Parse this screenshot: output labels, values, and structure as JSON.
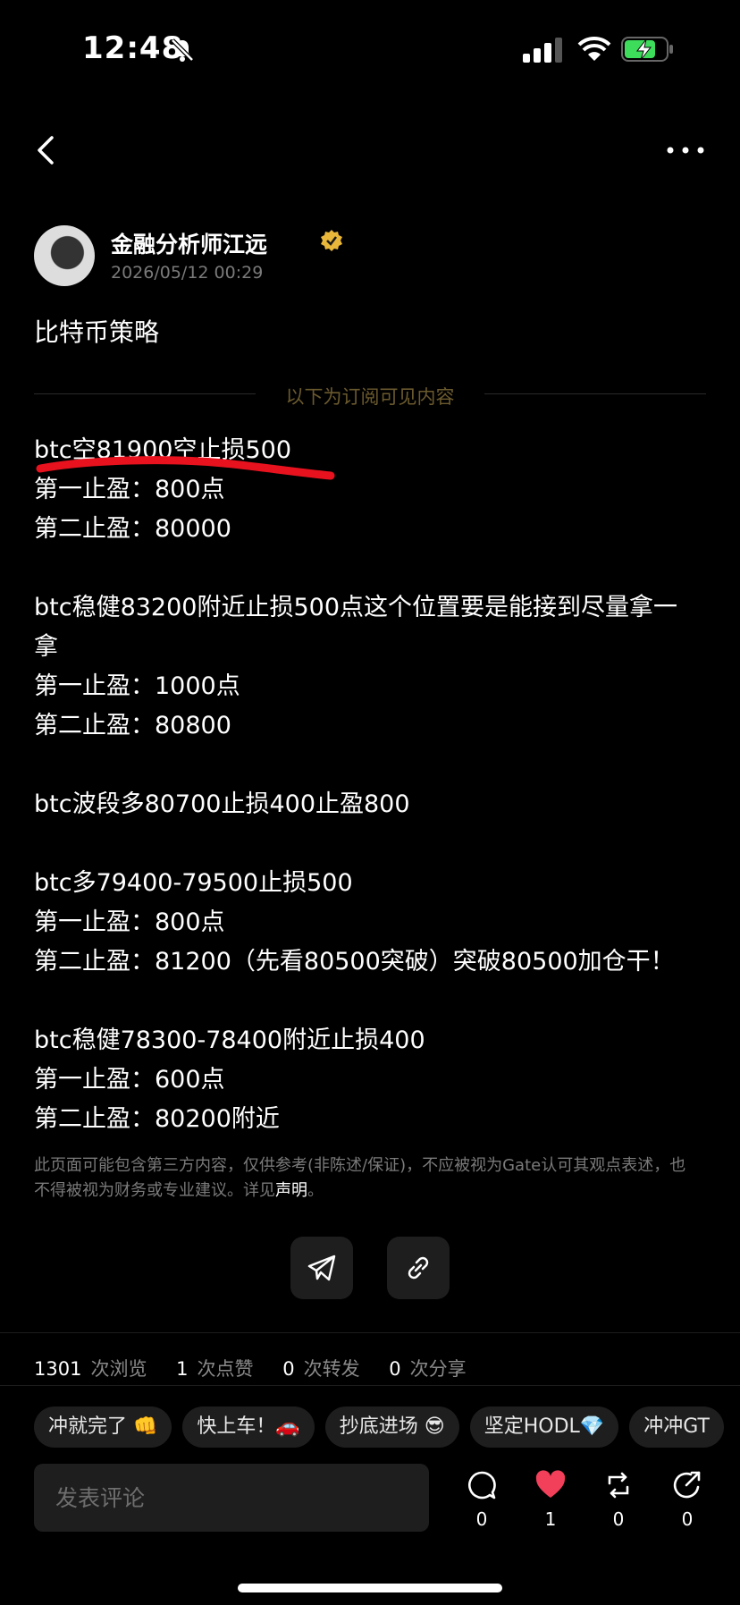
{
  "status_bar": {
    "time": "12:48"
  },
  "author": {
    "name": "金融分析师江远",
    "date": "2026/05/12 00:29"
  },
  "post": {
    "title": "比特币策略",
    "divider_text": "以下为订阅可见内容",
    "lines": [
      "btc空81900空止损500",
      "第一止盈：800点",
      "第二止盈：80000",
      "",
      "btc稳健83200附近止损500点这个位置要是能接到尽量拿一",
      "拿",
      "第一止盈：1000点",
      "第二止盈：80800",
      "",
      "btc波段多80700止损400止盈800",
      "",
      "btc多79400-79500止损500",
      "第一止盈：800点",
      "第二止盈：81200（先看80500突破）突破80500加仓干！",
      "",
      "btc稳健78300-78400附近止损400",
      "第一止盈：600点",
      "第二止盈：80200附近"
    ],
    "disclaimer": "此页面可能包含第三方内容，仅供参考(非陈述/保证)，不应被视为Gate认可其观点表述，也不得被视为财务或专业建议。详见",
    "disclaimer_link": "声明",
    "disclaimer_end": "。"
  },
  "stats": {
    "views": "1301",
    "views_label": "次浏览",
    "likes": "1",
    "likes_label": "次点赞",
    "reposts": "0",
    "reposts_label": "次转发",
    "shares": "0",
    "shares_label": "次分享"
  },
  "chips": [
    "冲就完了 👊",
    "快上车！🚗",
    "抄底进场 😎",
    "坚定HODL💎",
    "冲冲GT"
  ],
  "comment": {
    "placeholder": "发表评论"
  },
  "actions": {
    "comment_count": "0",
    "like_count": "1",
    "repost_count": "0",
    "share_count": "0"
  },
  "colors": {
    "background": "#000000",
    "like": "#f23f5a",
    "verified": "#e9b73a",
    "divider_text": "#6b5a2e",
    "underline": "#e8121e"
  },
  "icons": [
    "bell-mute-icon",
    "signal-icon",
    "wifi-icon",
    "battery-charging-icon",
    "back-arrow-icon",
    "more-icon",
    "verified-icon",
    "telegram-icon",
    "link-icon",
    "comment-icon",
    "heart-icon",
    "repost-icon",
    "share-icon"
  ]
}
